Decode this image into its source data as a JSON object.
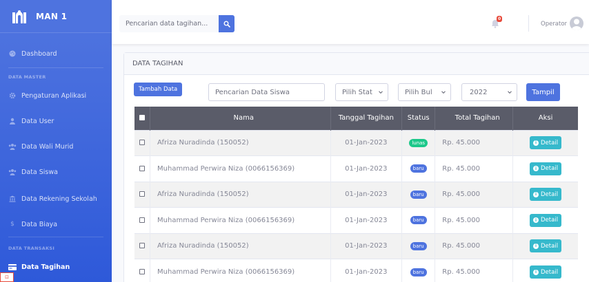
{
  "sidebar": {
    "brand": "MAN 1",
    "items": [
      {
        "key": "dashboard",
        "label": "Dashboard",
        "icon": "palette-icon"
      },
      {
        "key": "pengaturan",
        "label": "Pengaturan Aplikasi",
        "icon": "gear-icon"
      },
      {
        "key": "user",
        "label": "Data User",
        "icon": "user-icon"
      },
      {
        "key": "walimurid",
        "label": "Data Wali Murid",
        "icon": "users-icon"
      },
      {
        "key": "siswa",
        "label": "Data Siswa",
        "icon": "users-icon"
      },
      {
        "key": "rekening",
        "label": "Data Rekening Sekolah",
        "icon": "bank-icon"
      },
      {
        "key": "biaya",
        "label": "Data Biaya",
        "icon": "dollar-icon"
      },
      {
        "key": "tagihan",
        "label": "Data Tagihan",
        "icon": "card-icon",
        "active": true
      }
    ],
    "headings": {
      "master": "DATA MASTER",
      "transaksi": "DATA TRANSAKSI"
    }
  },
  "topbar": {
    "search_placeholder": "Pencarian data tagihan...",
    "notification_count": "0",
    "user_name": "Operator"
  },
  "card": {
    "title": "DATA TAGIHAN",
    "add_button": "Tambah Data",
    "search_placeholder": "Pencarian Data Siswa",
    "status_select": "Pilih Stat",
    "month_select": "Pilih Bul",
    "year_select": "2022",
    "show_button": "Tampil"
  },
  "table": {
    "headers": {
      "nama": "Nama",
      "tanggal": "Tanggal Tagihan",
      "status": "Status",
      "total": "Total Tagihan",
      "aksi": "Aksi"
    },
    "detail_label": "Detail",
    "rows": [
      {
        "nama": "Afriza Nuradinda (150052)",
        "tanggal": "01-Jan-2023",
        "status": "lunas",
        "total": "Rp. 45.000"
      },
      {
        "nama": "Muhammad Perwira Niza (0066156369)",
        "tanggal": "01-Jan-2023",
        "status": "baru",
        "total": "Rp. 45.000"
      },
      {
        "nama": "Afriza Nuradinda (150052)",
        "tanggal": "01-Jan-2023",
        "status": "baru",
        "total": "Rp. 45.000"
      },
      {
        "nama": "Muhammad Perwira Niza (0066156369)",
        "tanggal": "01-Jan-2023",
        "status": "baru",
        "total": "Rp. 45.000"
      },
      {
        "nama": "Afriza Nuradinda (150052)",
        "tanggal": "01-Jan-2023",
        "status": "baru",
        "total": "Rp. 45.000"
      },
      {
        "nama": "Muhammad Perwira Niza (0066156369)",
        "tanggal": "01-Jan-2023",
        "status": "baru",
        "total": "Rp. 45.000"
      }
    ]
  },
  "colors": {
    "primary": "#4e73df",
    "success": "#1cc88a",
    "info": "#36b9cc",
    "danger": "#e74a3b",
    "dark": "#5a5c69"
  }
}
